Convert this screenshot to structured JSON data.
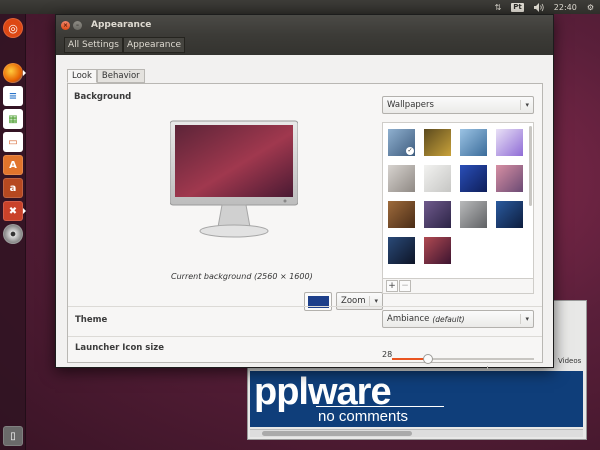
{
  "top_panel": {
    "network_icon": "network-arrows-icon",
    "keyboard_layout": "Pt",
    "volume_icon": "speaker-icon",
    "clock": "22:40",
    "settings_icon": "gear-icon"
  },
  "launcher": {
    "items": [
      {
        "name": "dash-home",
        "icon": "ubuntu-logo-icon",
        "color": "#dd4814"
      },
      {
        "name": "firefox",
        "icon": "firefox-icon",
        "color": "#e66000"
      },
      {
        "name": "writer",
        "icon": "libreoffice-writer-icon",
        "color": "#2a74c9"
      },
      {
        "name": "calc",
        "icon": "libreoffice-calc-icon",
        "color": "#4b9e2e"
      },
      {
        "name": "impress",
        "icon": "libreoffice-impress-icon",
        "color": "#d6602a"
      },
      {
        "name": "software-center",
        "icon": "software-center-icon",
        "color": "#e1742c"
      },
      {
        "name": "amazon",
        "icon": "amazon-icon",
        "color": "#b64820"
      },
      {
        "name": "system-settings",
        "icon": "system-settings-icon",
        "color": "#c9422a"
      },
      {
        "name": "dvd",
        "icon": "disc-icon",
        "color": "#8a8a8a"
      }
    ],
    "trash_icon": "trash-icon"
  },
  "background_window": {
    "title": "ware",
    "videos_label": "Videos",
    "banner_title": "pplware",
    "banner_subtitle": "no comments"
  },
  "window": {
    "title": "Appearance",
    "breadcrumbs": [
      "All Settings",
      "Appearance"
    ],
    "tabs": [
      "Look",
      "Behavior"
    ],
    "active_tab": "Look"
  },
  "background": {
    "label": "Background",
    "source_select": "Wallpapers",
    "caption": "Current background (2560 × 1600)",
    "color_swatch": "#1d3f8a",
    "placement_select": "Zoom",
    "add_button": "+",
    "remove_button": "−",
    "wallpapers": [
      {
        "name": "wallpaper-mountain-lake",
        "colors": [
          "#8fb0cf",
          "#3e5c7e"
        ],
        "selected": true
      },
      {
        "name": "wallpaper-mushroom",
        "colors": [
          "#5b4a1e",
          "#c9a23a"
        ],
        "selected": false
      },
      {
        "name": "wallpaper-waterfall",
        "colors": [
          "#9bc3e4",
          "#3b6c9a"
        ],
        "selected": false
      },
      {
        "name": "wallpaper-flower",
        "colors": [
          "#e9e1f6",
          "#8f6cd6"
        ],
        "selected": false
      },
      {
        "name": "wallpaper-fog",
        "colors": [
          "#d7d3cf",
          "#8f8984"
        ],
        "selected": false
      },
      {
        "name": "wallpaper-white-flower",
        "colors": [
          "#f2f2f0",
          "#c6c6c4"
        ],
        "selected": false
      },
      {
        "name": "wallpaper-blue-abstract",
        "colors": [
          "#2a4fb8",
          "#0e1e5a"
        ],
        "selected": false
      },
      {
        "name": "wallpaper-pink-sunset",
        "colors": [
          "#d78fa3",
          "#6b4a74"
        ],
        "selected": false
      },
      {
        "name": "wallpaper-tree-rings",
        "colors": [
          "#9e6b3c",
          "#4a2c16"
        ],
        "selected": false
      },
      {
        "name": "wallpaper-purple-sky",
        "colors": [
          "#6f5a8c",
          "#2c2446"
        ],
        "selected": false
      },
      {
        "name": "wallpaper-grey-bird",
        "colors": [
          "#b9babb",
          "#5f6164"
        ],
        "selected": false
      },
      {
        "name": "wallpaper-blue-bokeh",
        "colors": [
          "#2a5a9e",
          "#0d1d3e"
        ],
        "selected": false
      },
      {
        "name": "wallpaper-night-sky",
        "colors": [
          "#2a4a78",
          "#0d1426"
        ],
        "selected": false
      },
      {
        "name": "wallpaper-ubuntu-default",
        "colors": [
          "#b14a52",
          "#3c1430"
        ],
        "selected": false
      }
    ]
  },
  "theme": {
    "label": "Theme",
    "value": "Ambiance",
    "qualifier": "(default)"
  },
  "launcher_icon_size": {
    "label": "Launcher Icon size",
    "value": "28",
    "min": 16,
    "max": 64
  },
  "accent_color": "#e95420"
}
